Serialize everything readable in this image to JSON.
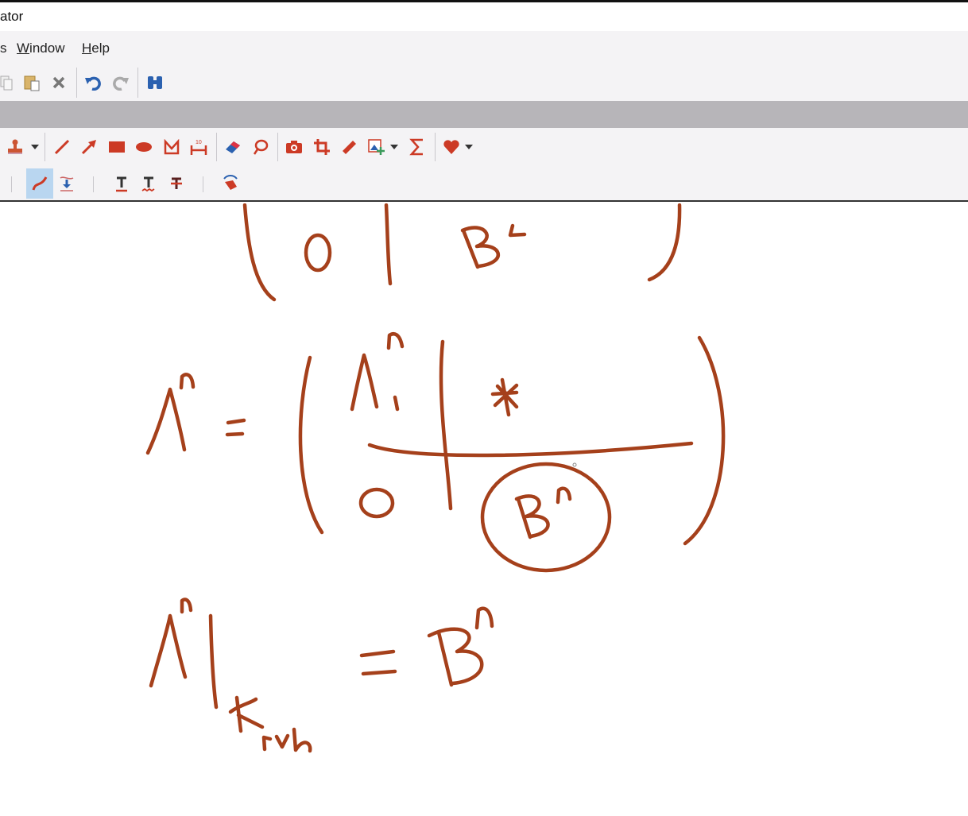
{
  "window": {
    "title_fragment": "ator"
  },
  "menu": {
    "items": [
      {
        "label": "s"
      },
      {
        "label": "Window"
      },
      {
        "label": "Help"
      }
    ]
  },
  "toolbar_main": {
    "icons": [
      "copy-icon",
      "paste-icon",
      "delete-icon",
      "undo-icon",
      "redo-icon",
      "find-icon"
    ]
  },
  "toolbar_comment": {
    "icons": [
      "stamp-icon",
      "line-icon",
      "arrow-icon",
      "rectangle-icon",
      "ellipse-icon",
      "polygon-icon",
      "distance-icon",
      "eraser-icon",
      "lasso-icon",
      "snapshot-icon",
      "crop-icon",
      "ruler-icon",
      "add-image-icon",
      "sum-icon",
      "favorite-icon"
    ],
    "measure_label": "10"
  },
  "toolbar_markup": {
    "icons": [
      "pencil-icon",
      "insert-text-icon",
      "underline-text-icon",
      "squiggly-text-icon",
      "strikeout-text-icon",
      "hand-icon"
    ],
    "selected": "pencil-icon"
  },
  "colors": {
    "ink": "#a5401b",
    "accent_red": "#cc3a25",
    "blue": "#2b61b0"
  }
}
